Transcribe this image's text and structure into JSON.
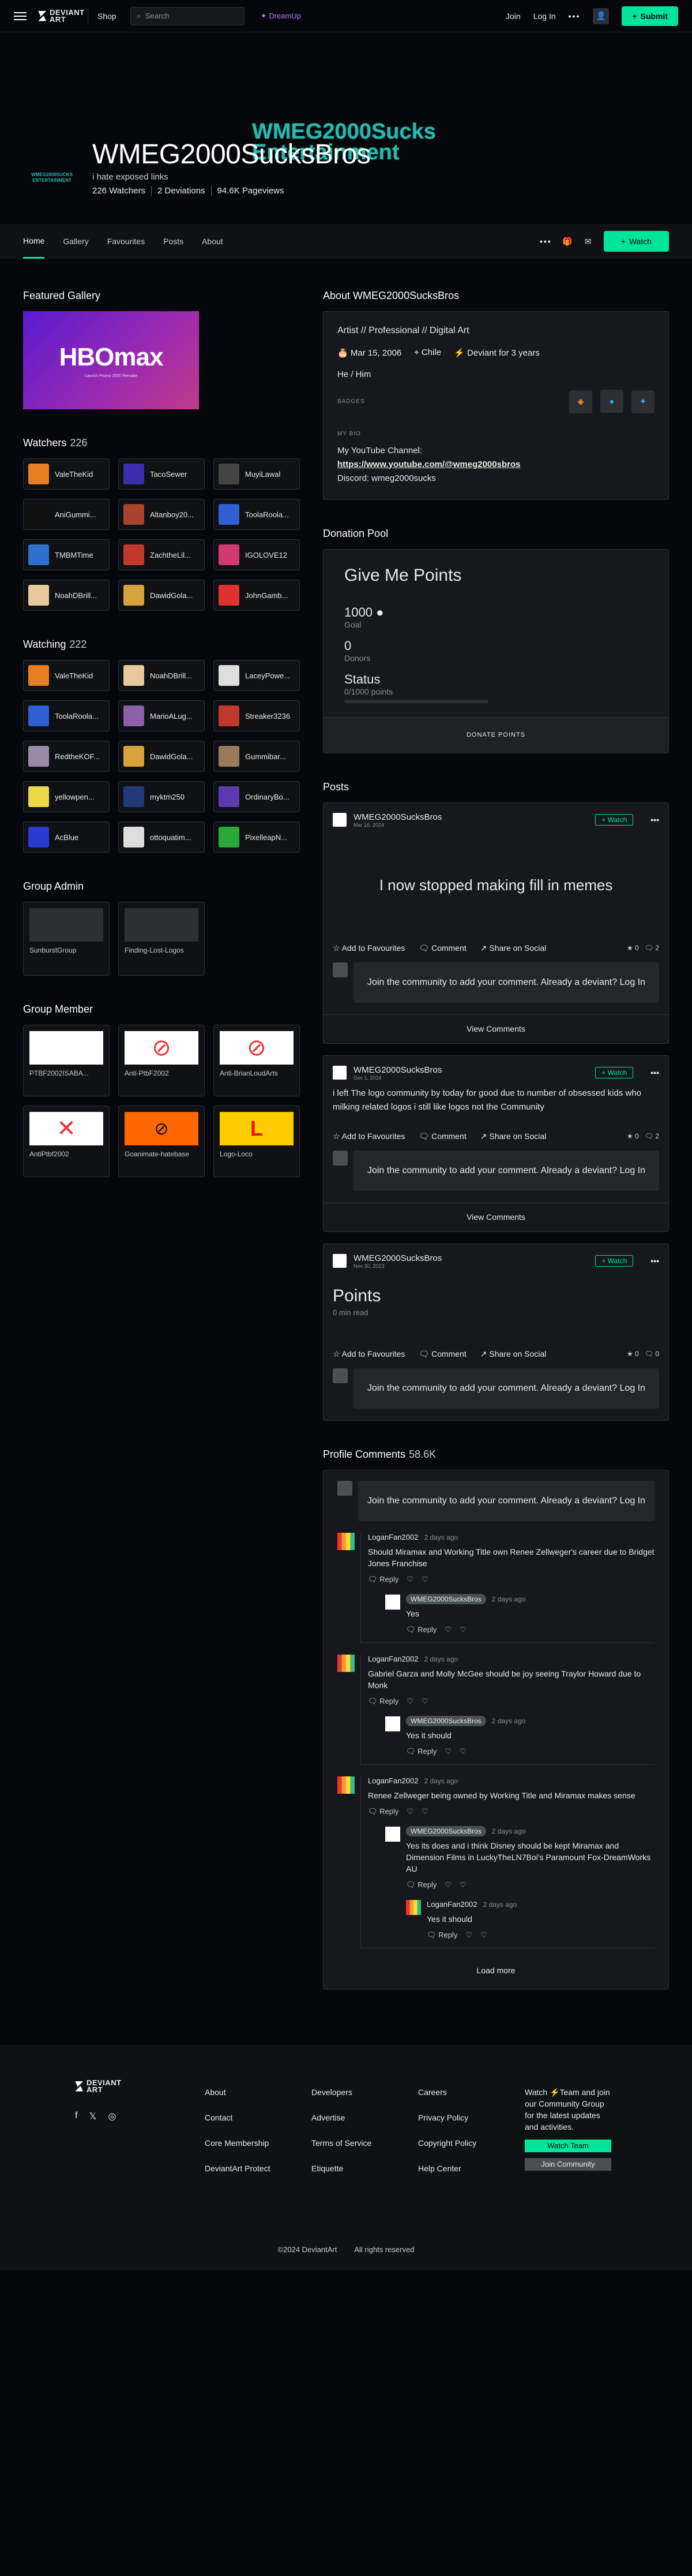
{
  "nav": {
    "logo": "DEVIANT ART",
    "shop": "Shop",
    "search_placeholder": "Search",
    "dreamup": "DreamUp",
    "join": "Join",
    "login": "Log In",
    "more": "•••",
    "submit": "Submit"
  },
  "profile": {
    "banner_text": "WMEG2000Sucks Entertainment",
    "avatar_text": "WMEG2000SUCKS ENTERTAINMENT",
    "name": "WMEG2000SucksBros",
    "tagline": "i hate exposed links",
    "watchers": "226 Watchers",
    "deviations": "2 Deviations",
    "pageviews": "94.6K Pageviews"
  },
  "tabs": [
    "Home",
    "Gallery",
    "Favourites",
    "Posts",
    "About"
  ],
  "watch_label": "Watch",
  "featured": {
    "title": "Featured Gallery",
    "thumb_title": "HBOmax",
    "thumb_sub": "Launch Promo 2020 Remake"
  },
  "watchers": {
    "title": "Watchers",
    "count": "226",
    "users": [
      {
        "name": "ValeTheKid",
        "color": "#e67e22"
      },
      {
        "name": "TacoSewer",
        "color": "#3b2fb0"
      },
      {
        "name": "MuyiLawal",
        "color": "#444"
      },
      {
        "name": "AniGummi...",
        "color": "#111"
      },
      {
        "name": "Altanboy20...",
        "color": "#a8432e"
      },
      {
        "name": "ToolaRoola...",
        "color": "#2f5fd0"
      },
      {
        "name": "TMBMTime",
        "color": "#2f6fd0"
      },
      {
        "name": "ZachtheLil...",
        "color": "#c0392b"
      },
      {
        "name": "IGOLOVE12",
        "color": "#d03a6f"
      },
      {
        "name": "NoahDBrill...",
        "color": "#e8c89c"
      },
      {
        "name": "DawidGola...",
        "color": "#d8a23a"
      },
      {
        "name": "JohnGamb...",
        "color": "#e03030"
      }
    ]
  },
  "watching": {
    "title": "Watching",
    "count": "222",
    "users": [
      {
        "name": "ValeTheKid",
        "color": "#e67e22"
      },
      {
        "name": "NoahDBrill...",
        "color": "#e8c89c"
      },
      {
        "name": "LaceyPowe...",
        "color": "#ddd"
      },
      {
        "name": "ToolaRoola...",
        "color": "#2f5fd0"
      },
      {
        "name": "MarioALug...",
        "color": "#8c5fa8"
      },
      {
        "name": "Streaker3236",
        "color": "#c0392b"
      },
      {
        "name": "RedtheKOF...",
        "color": "#9a8aa8"
      },
      {
        "name": "DawidGola...",
        "color": "#d8a23a"
      },
      {
        "name": "Gummibar...",
        "color": "#9a7a5a"
      },
      {
        "name": "yellowpen...",
        "color": "#e8d84a"
      },
      {
        "name": "myktm250",
        "color": "#223a7a"
      },
      {
        "name": "OrdinaryBo...",
        "color": "#5a3ab0"
      },
      {
        "name": "AcBlue",
        "color": "#2a3ad0"
      },
      {
        "name": "ottoquatim...",
        "color": "#ddd"
      },
      {
        "name": "PixelleapN...",
        "color": "#2aa83a"
      }
    ]
  },
  "group_admin": {
    "title": "Group Admin",
    "groups": [
      "SunburstGroup",
      "Finding-Lost-Logos"
    ]
  },
  "group_member": {
    "title": "Group Member",
    "groups": [
      "PTBF2002ISABA...",
      "Anti-PtbF2002",
      "Anti-BrianLoudArts",
      "AntiPtbf2002",
      "Goanimate-hatebase",
      "Logo-Loco"
    ]
  },
  "about": {
    "title": "About WMEG2000SucksBros",
    "line": "Artist  //  Professional  //  Digital Art",
    "birthday": "Mar 15, 2006",
    "country": "Chile",
    "member": "Deviant for 3 years",
    "pronouns": "He / Him",
    "badges_label": "BADGES",
    "bio_label": "MY BIO",
    "bio_1": "My YouTube Channel:",
    "bio_link": "https://www.youtube.com/@wmeg2000sbros",
    "bio_2": "Discord: wmeg2000sucks"
  },
  "donation": {
    "title": "Donation Pool",
    "heading": "Give Me Points",
    "goal_value": "1000",
    "goal_label": "Goal",
    "donors_value": "0",
    "donors_label": "Donors",
    "status_label": "Status",
    "status_value": "0/1000 points",
    "progress": 0,
    "button": "DONATE POINTS"
  },
  "posts": {
    "title": "Posts",
    "items": [
      {
        "author": "WMEG2000SucksBros",
        "date": "Mar 16, 2024",
        "body": "I now stopped making fill in memes",
        "likes": "0",
        "comments": "2"
      },
      {
        "author": "WMEG2000SucksBros",
        "date": "Dec 1, 2024",
        "body": "i left The logo community by today for good due to number of obsessed kids who milking related logos i still like logos not the Community",
        "likes": "0",
        "comments": "2"
      },
      {
        "author": "WMEG2000SucksBros",
        "date": "Nov 30, 2023",
        "title": "Points",
        "sub": "0 min read",
        "likes": "0",
        "comments": "0"
      }
    ],
    "watch": "+ Watch",
    "add_fav": "Add to Favourites",
    "comment": "Comment",
    "share": "Share on Social",
    "join_text": "Join the community to add your comment. Already a deviant? Log In",
    "view_comments": "View Comments"
  },
  "profile_comments": {
    "title": "Profile Comments",
    "count": "58.6K",
    "join_text": "Join the community to add your comment. Already a deviant? Log In",
    "reply": "Reply",
    "load_more": "Load more",
    "items": [
      {
        "user": "LoganFan2002",
        "ago": "2 days ago",
        "text": "Should Miramax and Working Title own Renee Zellweger's career due to Bridget Jones Franchise",
        "reply_user": "WMEG2000SucksBros",
        "reply_ago": "2 days ago",
        "reply_text": "Yes"
      },
      {
        "user": "LoganFan2002",
        "ago": "2 days ago",
        "text": "Gabriel Garza and Molly McGee should be joy seeing Traylor Howard due to Monk",
        "reply_user": "WMEG2000SucksBros",
        "reply_ago": "2 days ago",
        "reply_text": "Yes it should"
      },
      {
        "user": "LoganFan2002",
        "ago": "2 days ago",
        "text": "Renee Zellweger being owned by Working Title and Miramax makes sense",
        "reply_user": "WMEG2000SucksBros",
        "reply_ago": "2 days ago",
        "reply_text": "Yes its does and i think Disney should be kept Miramax and Dimension Films in LuckyTheLN7Boi's Paramount Fox-DreamWorks AU",
        "reply2_user": "LoganFan2002",
        "reply2_ago": "2 days ago",
        "reply2_text": "Yes it should"
      }
    ]
  },
  "footer": {
    "col1": [
      "About",
      "Contact",
      "Core Membership",
      "DeviantArt Protect"
    ],
    "col2": [
      "Developers",
      "Advertise",
      "Terms of Service",
      "Etiquette"
    ],
    "col3": [
      "Careers",
      "Privacy Policy",
      "Copyright Policy",
      "Help Center"
    ],
    "cta": "Watch ⚡Team and join our Community Group for the latest updates and activities.",
    "cta_btn1": "Watch Team",
    "cta_btn2": "Join Community",
    "copyright": "©2024 DeviantArt",
    "rights": "All rights reserved"
  }
}
